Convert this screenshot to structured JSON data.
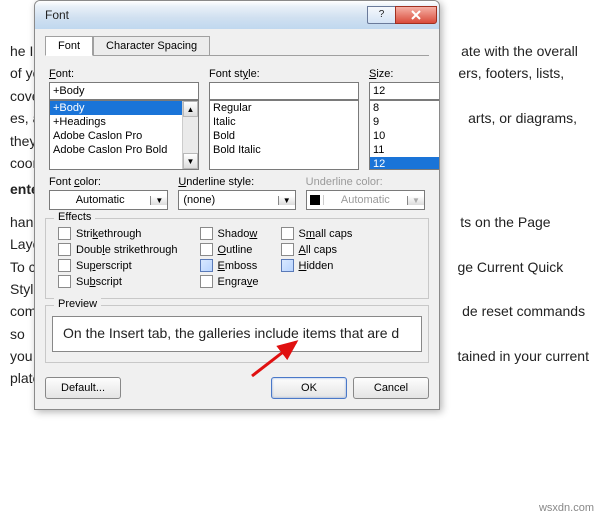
{
  "dialog": {
    "title": "Font",
    "tabs": {
      "font": "Font",
      "spacing": "Character Spacing"
    },
    "labels": {
      "font": "Font:",
      "style": "Font style:",
      "size": "Size:",
      "font_color": "Font color:",
      "underline_style": "Underline style:",
      "underline_color": "Underline color:",
      "effects": "Effects",
      "preview": "Preview"
    },
    "font_field": "+Body",
    "font_list": [
      "+Body",
      "+Headings",
      "Adobe Caslon Pro",
      "Adobe Caslon Pro Bold"
    ],
    "font_sel_index": 0,
    "style_field": "",
    "style_list": [
      "Regular",
      "Italic",
      "Bold",
      "Bold Italic"
    ],
    "size_field": "12",
    "size_list": [
      "8",
      "9",
      "10",
      "11",
      "12"
    ],
    "size_sel_index": 4,
    "font_color": "Automatic",
    "underline_style": "(none)",
    "underline_color": "Automatic",
    "effects": {
      "strikethrough": "Strikethrough",
      "double_strikethrough": "Double strikethrough",
      "superscript": "Superscript",
      "subscript": "Subscript",
      "shadow": "Shadow",
      "outline": "Outline",
      "emboss": "Emboss",
      "engrave": "Engrave",
      "small_caps": "Small caps",
      "all_caps": "All caps",
      "hidden": "Hidden"
    },
    "preview_text": "On the Insert tab, the galleries include items that are d",
    "buttons": {
      "default": "Default...",
      "ok": "OK",
      "cancel": "Cancel"
    }
  },
  "bg": {
    "p1a": "he In",
    "p1b": "ate with the overall",
    "p2a": " of yo",
    "p2b": "ers, footers, lists, cover",
    "p3a": "es, an",
    "p3b": "arts, or diagrams, they",
    "p4a": " coord",
    "p5a": " ente",
    "p6a": "hangi",
    "p6b": "ts on the Page Layout",
    "p7a": " To ch",
    "p7b": "ge Current Quick Style",
    "p8a": "comm",
    "p8b": "de reset commands so",
    "p9a": " you c",
    "p9b": "tained in your current",
    "p10a": "plate"
  },
  "watermark": "wsxdn.com"
}
